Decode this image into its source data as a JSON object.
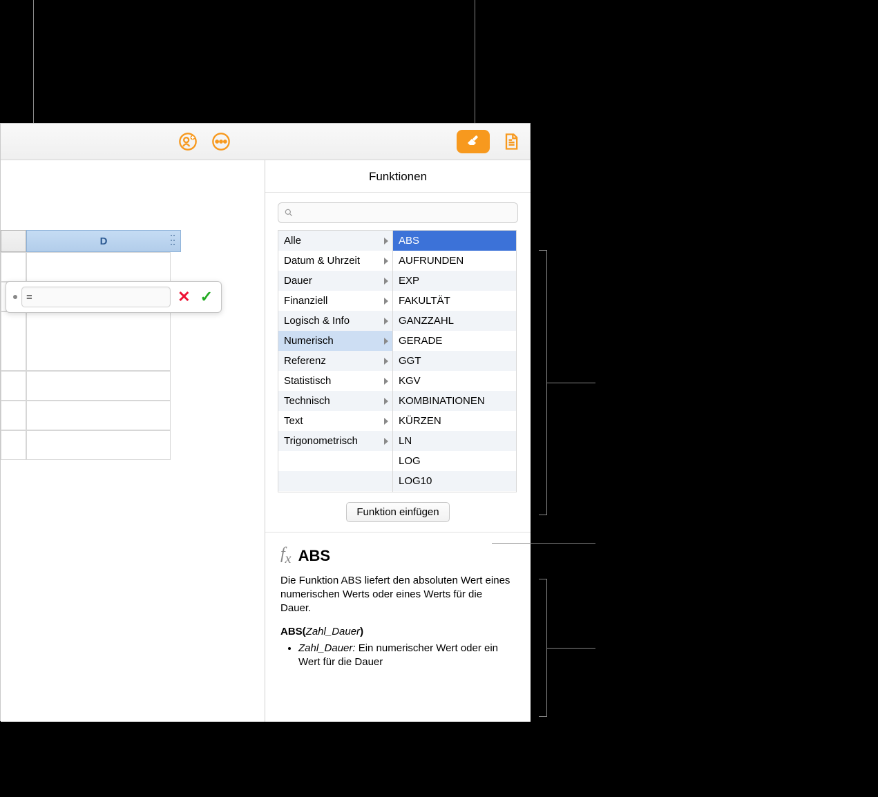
{
  "toolbar": {
    "collab_icon": "collaborate-icon",
    "more_icon": "more-icon",
    "format_icon": "format-brush-icon",
    "doc_icon": "document-icon"
  },
  "sheet": {
    "col_label": "D"
  },
  "formula_editor": {
    "value": "=",
    "cancel": "✕",
    "accept": "✓"
  },
  "sidebar": {
    "title": "Funktionen",
    "search_placeholder": "",
    "categories": [
      "Alle",
      "Datum & Uhrzeit",
      "Dauer",
      "Finanziell",
      "Logisch & Info",
      "Numerisch",
      "Referenz",
      "Statistisch",
      "Technisch",
      "Text",
      "Trigonometrisch"
    ],
    "selected_category_index": 5,
    "functions": [
      "ABS",
      "AUFRUNDEN",
      "EXP",
      "FAKULTÄT",
      "GANZZAHL",
      "GERADE",
      "GGT",
      "KGV",
      "KOMBINATIONEN",
      "KÜRZEN",
      "LN",
      "LOG",
      "LOG10"
    ],
    "selected_function_index": 0,
    "insert_label": "Funktion einfügen",
    "help": {
      "name": "ABS",
      "description": "Die Funktion ABS liefert den absoluten Wert eines numerischen Werts oder eines Werts für die Dauer.",
      "signature_prefix": "ABS(",
      "signature_arg": "Zahl_Dauer",
      "signature_suffix": ")",
      "arg_name": "Zahl_Dauer:",
      "arg_desc": " Ein numerischer Wert oder ein Wert für die Dauer"
    }
  }
}
